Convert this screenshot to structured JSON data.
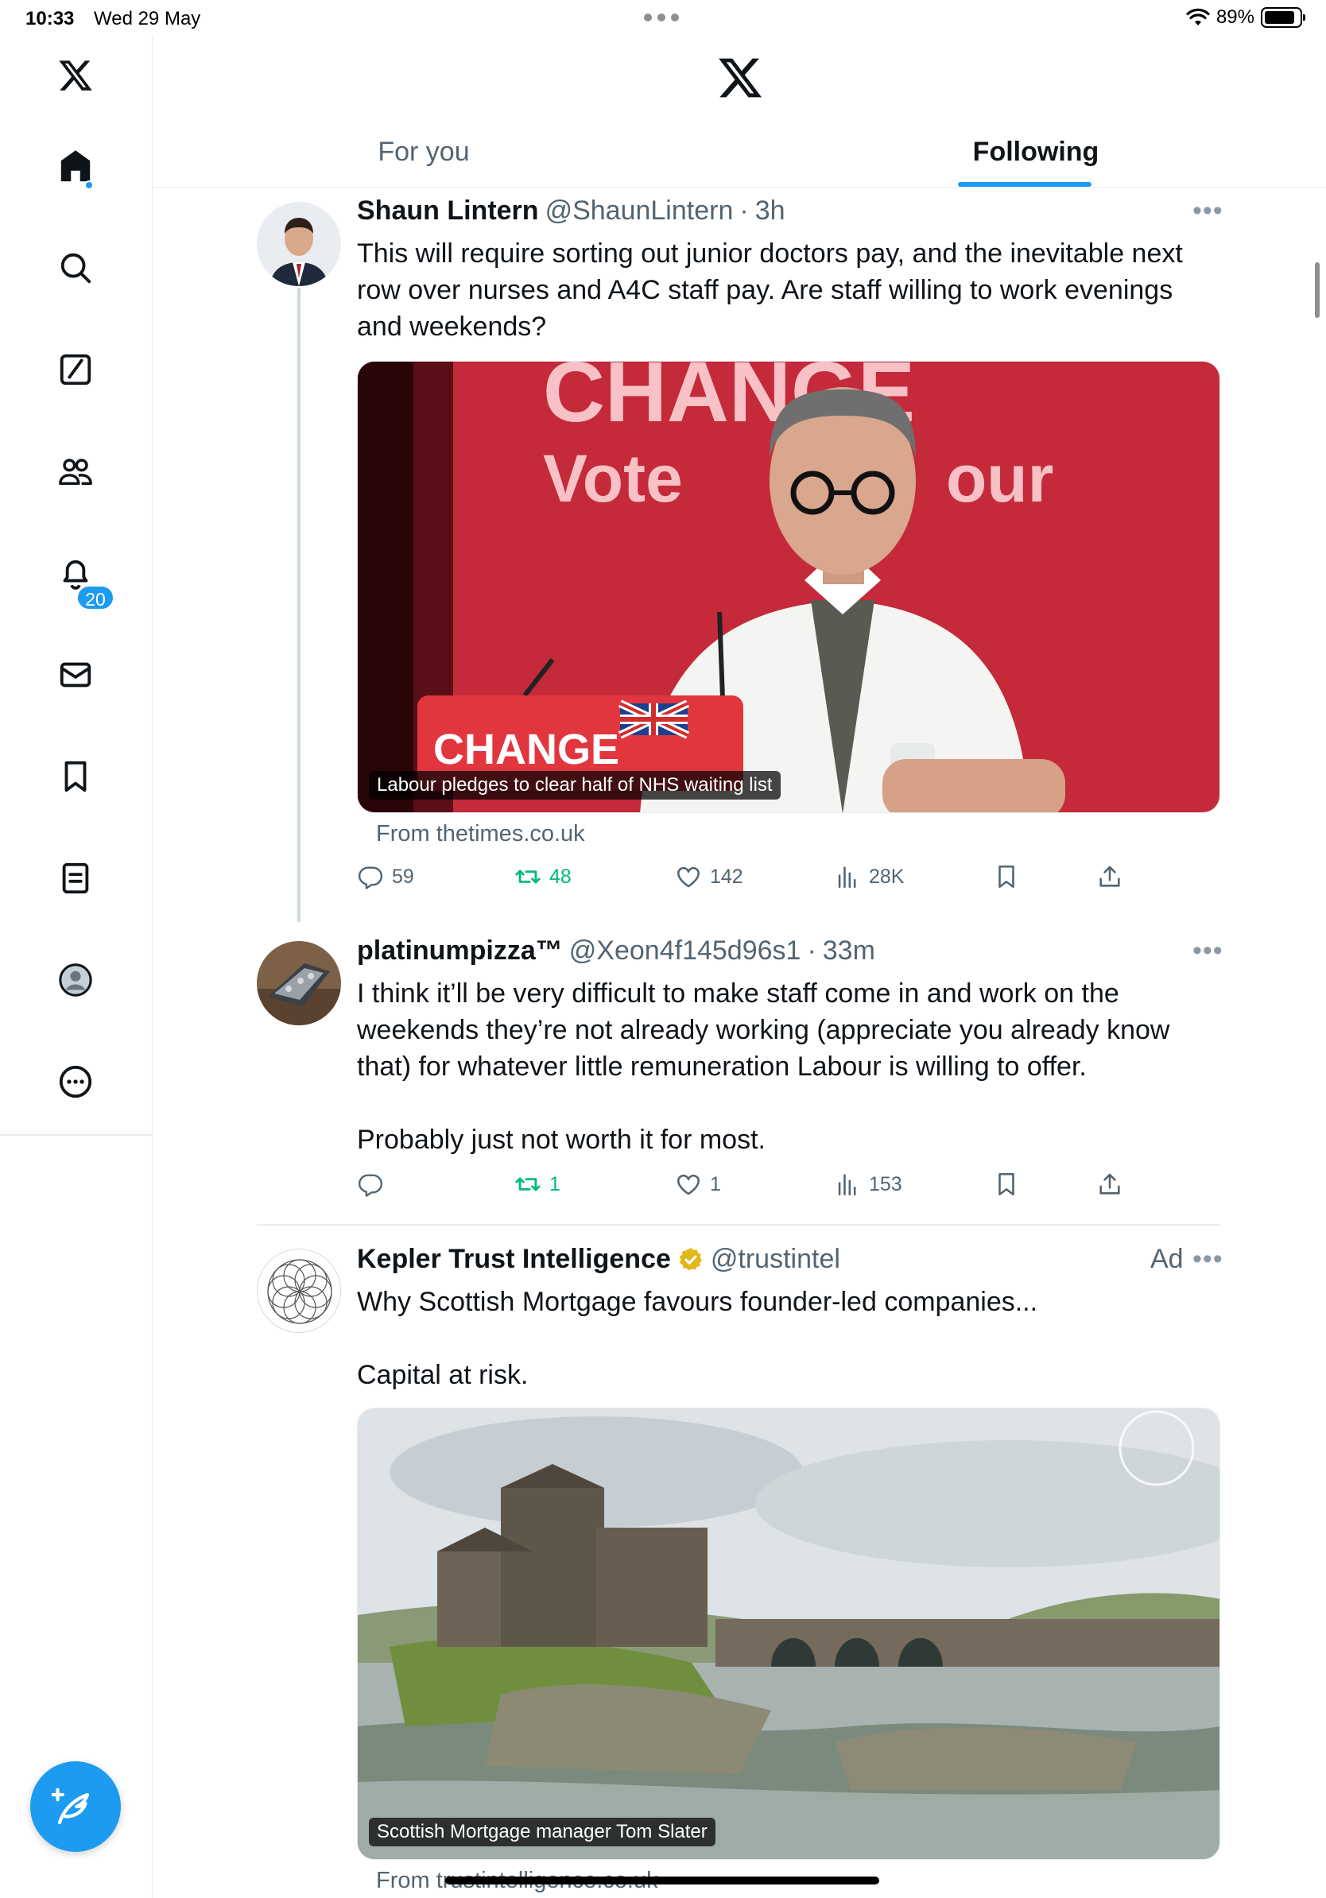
{
  "status_bar": {
    "time": "10:33",
    "date": "Wed 29 May",
    "battery": "89%",
    "battery_level": 0.89
  },
  "sidebar": {
    "items": [
      {
        "name": "x-logo",
        "icon": "x-logo-icon"
      },
      {
        "name": "home",
        "icon": "home-icon"
      },
      {
        "name": "explore",
        "icon": "search-icon"
      },
      {
        "name": "grok",
        "icon": "grok-icon"
      },
      {
        "name": "communities",
        "icon": "people-icon"
      },
      {
        "name": "notifications",
        "icon": "bell-icon",
        "badge": "20"
      },
      {
        "name": "messages",
        "icon": "mail-icon"
      },
      {
        "name": "bookmarks",
        "icon": "bookmark-icon"
      },
      {
        "name": "lists",
        "icon": "list-icon"
      },
      {
        "name": "profile",
        "icon": "profile-icon"
      },
      {
        "name": "more",
        "icon": "more-circle-icon"
      }
    ],
    "compose_icon": "compose-feather-icon"
  },
  "header": {
    "tabs": [
      {
        "label": "For you",
        "active": false
      },
      {
        "label": "Following",
        "active": true
      }
    ]
  },
  "colors": {
    "accent": "#1d9bf0",
    "retweet_active": "#00ba7c",
    "text": "#0f1419",
    "muted": "#536471"
  },
  "tweets": [
    {
      "name": "Shaun Lintern",
      "handle": "@ShaunLintern",
      "time": "3h",
      "text": "This will require sorting out junior doctors pay, and the inevitable next row over nurses and A4C staff pay. Are staff willing to work evenings and weekends?",
      "media_caption": "Labour pledges to clear half of NHS waiting list",
      "media_sign_top": "CHANGE",
      "media_sign_vote": "Vote",
      "media_sign_party": "our",
      "media_podium": "CHANGE",
      "link_source": "From thetimes.co.uk",
      "stats": {
        "replies": "59",
        "retweets": "48",
        "likes": "142",
        "views": "28K"
      }
    },
    {
      "name": "platinumpizza™",
      "handle": "@Xeon4f145d96s1",
      "time": "33m",
      "text": "I think it’ll be very difficult to make staff come in and work on the weekends they’re not already working (appreciate you already know that) for whatever little remuneration Labour is willing to offer.\n\nProbably just not worth it for most.",
      "stats": {
        "replies": "",
        "retweets": "1",
        "likes": "1",
        "views": "153"
      }
    },
    {
      "name": "Kepler Trust Intelligence",
      "handle": "@trustintel",
      "ad_label": "Ad",
      "verified": true,
      "text": "Why Scottish Mortgage favours founder-led companies...\n\nCapital at risk.",
      "media_caption": "Scottish Mortgage manager Tom Slater",
      "link_source": "From trustintelligence.co.uk"
    }
  ]
}
